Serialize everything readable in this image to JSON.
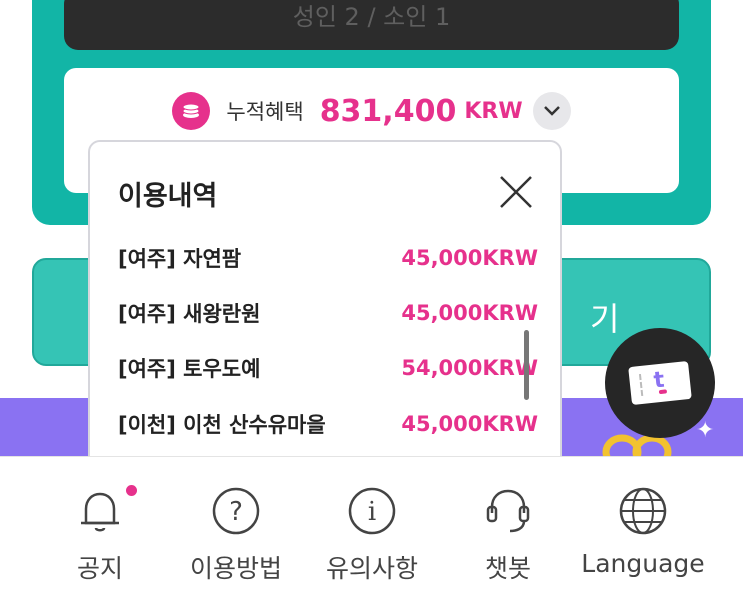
{
  "booking": {
    "passengers": "성인 2 / 소인 1"
  },
  "benefit": {
    "label": "누적혜택",
    "amount": "831,400",
    "unit": "KRW",
    "icon": "coin-stack-icon",
    "toggle_icon": "chevron-down-icon"
  },
  "teal_button": {
    "label_fragment": "기"
  },
  "history": {
    "title": "이용내역",
    "close_icon": "close-icon",
    "items": [
      {
        "place": "[여주] 자연팜",
        "price": "45,000KRW"
      },
      {
        "place": "[여주] 새왕란원",
        "price": "45,000KRW"
      },
      {
        "place": "[여주] 토우도예",
        "price": "54,000KRW"
      },
      {
        "place": "[이천] 이천 산수유마을",
        "price": "45,000KRW"
      }
    ]
  },
  "fab": {
    "icon": "ticket-icon"
  },
  "nav": {
    "items": [
      {
        "label": "공지",
        "icon": "bell-icon",
        "has_badge": true
      },
      {
        "label": "이용방법",
        "icon": "question-circle-icon"
      },
      {
        "label": "유의사항",
        "icon": "info-circle-icon"
      },
      {
        "label": "챗봇",
        "icon": "headset-icon"
      },
      {
        "label": "Language",
        "icon": "globe-icon"
      }
    ]
  },
  "colors": {
    "accent_pink": "#e6318c",
    "teal": "#12b5a6",
    "purple": "#8a72f2"
  }
}
